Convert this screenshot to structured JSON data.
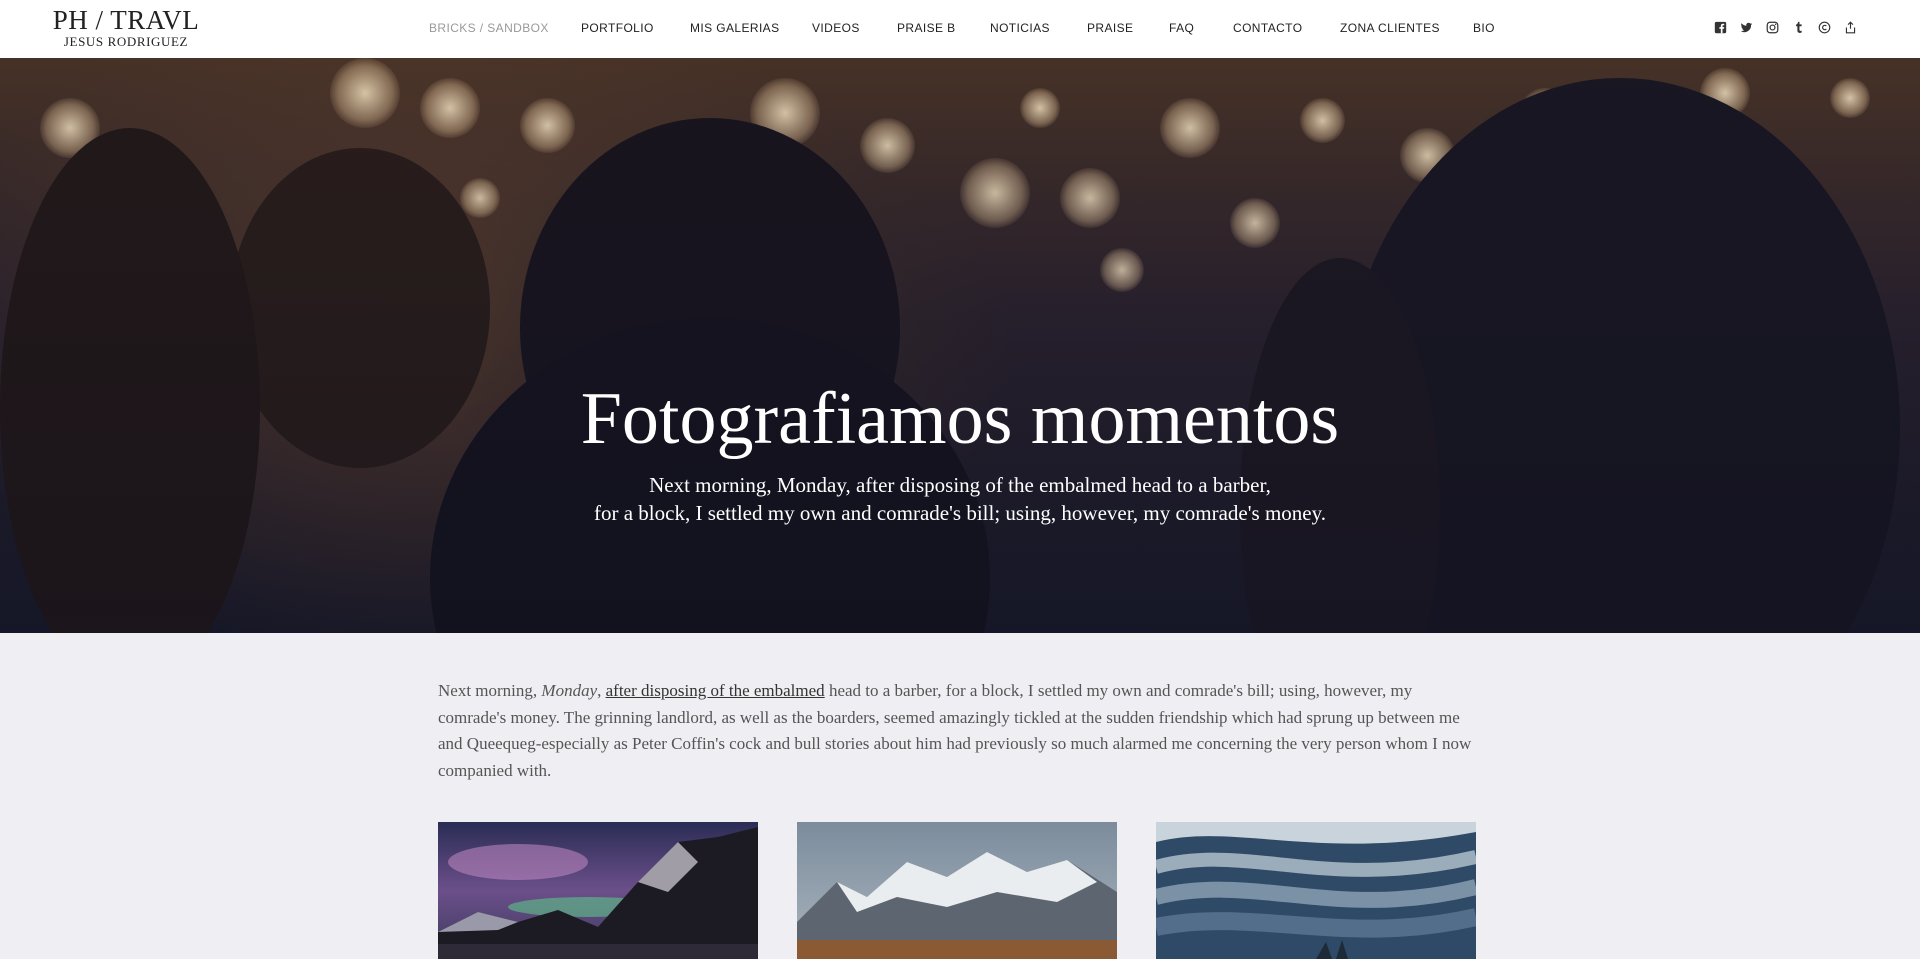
{
  "site": {
    "logo_main": "PH / TRAVL",
    "logo_sub": "JESUS RODRIGUEZ"
  },
  "nav": {
    "items": [
      {
        "label": "BRICKS / SANDBOX",
        "active": true
      },
      {
        "label": "PORTFOLIO"
      },
      {
        "label": "MIS GALERIAS"
      },
      {
        "label": "VIDEOS"
      },
      {
        "label": "PRAISE B"
      },
      {
        "label": "NOTICIAS"
      },
      {
        "label": "PRAISE"
      },
      {
        "label": "FAQ"
      },
      {
        "label": "CONTACTO"
      },
      {
        "label": "ZONA CLIENTES"
      },
      {
        "label": "BIO"
      }
    ]
  },
  "socials": [
    "facebook-icon",
    "twitter-icon",
    "instagram-icon",
    "tumblr-icon",
    "copyright-icon",
    "share-icon"
  ],
  "hero": {
    "title": "Fotografiamos momentos",
    "subtitle_line1": "Next morning, Monday, after disposing of the embalmed head to a barber,",
    "subtitle_line2": "for a block, I settled my own and comrade's bill; using, however, my comrade's money."
  },
  "intro": {
    "part1": "Next morning, ",
    "italic": "Monday",
    "part2": ", ",
    "link": "after disposing of the embalmed",
    "part3": " head to a barber, for a block, I settled my own and comrade's bill; using, however, my comrade's money. The grinning landlord, as well as the boarders, seemed amazingly tickled at the sudden friendship which had sprung up between me and Queequeg-especially as Peter Coffin's cock and bull stories about him had previously so much alarmed me concerning the very person whom I now companied with."
  },
  "gallery": [
    {
      "name": "aurora-mountains-image"
    },
    {
      "name": "snowy-peaks-image"
    },
    {
      "name": "misty-waves-image"
    }
  ],
  "colors": {
    "accent_text": "#222222",
    "nav_active": "#999999",
    "page_bg": "#efeef2"
  }
}
